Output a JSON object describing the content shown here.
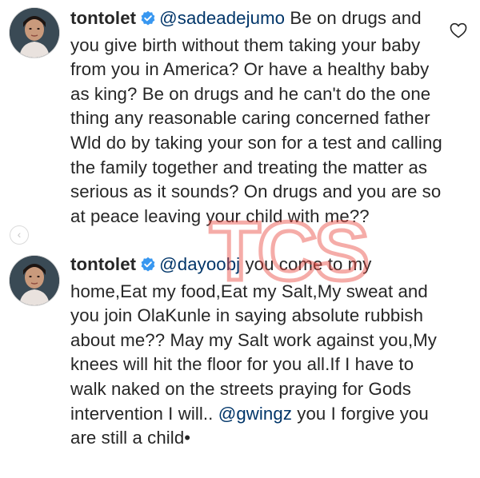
{
  "comments": [
    {
      "username": "tontolet",
      "mention": "@sadeadejumo",
      "text": "Be on drugs and you give birth without them taking your baby from you in America? Or have a healthy baby as king? Be on drugs and he can't do the one thing any reasonable caring concerned father Wld do by taking your son for a test and calling the family together and treating the matter as serious as it sounds? On drugs and you are so at peace leaving your child with me??"
    },
    {
      "username": "tontolet",
      "mention": "@dayoobj",
      "text": "you come to my home,Eat my food,Eat my Salt,My sweat and you join OlaKunle in saying absolute rubbish about me?? May my Salt work against you,My knees will hit the floor for you all.If I have to walk naked on the streets praying for Gods intervention I will..",
      "mention_2": "@gwingz",
      "text_2": "you I forgive  you are still a child•"
    }
  ],
  "watermark": "TCS",
  "icons": {
    "verified": "verified-badge-icon",
    "like": "heart-icon",
    "scroll": "chevron-left-icon"
  },
  "colors": {
    "verified": "#3897f0",
    "mention": "#003569",
    "watermark": "#e8473f"
  }
}
